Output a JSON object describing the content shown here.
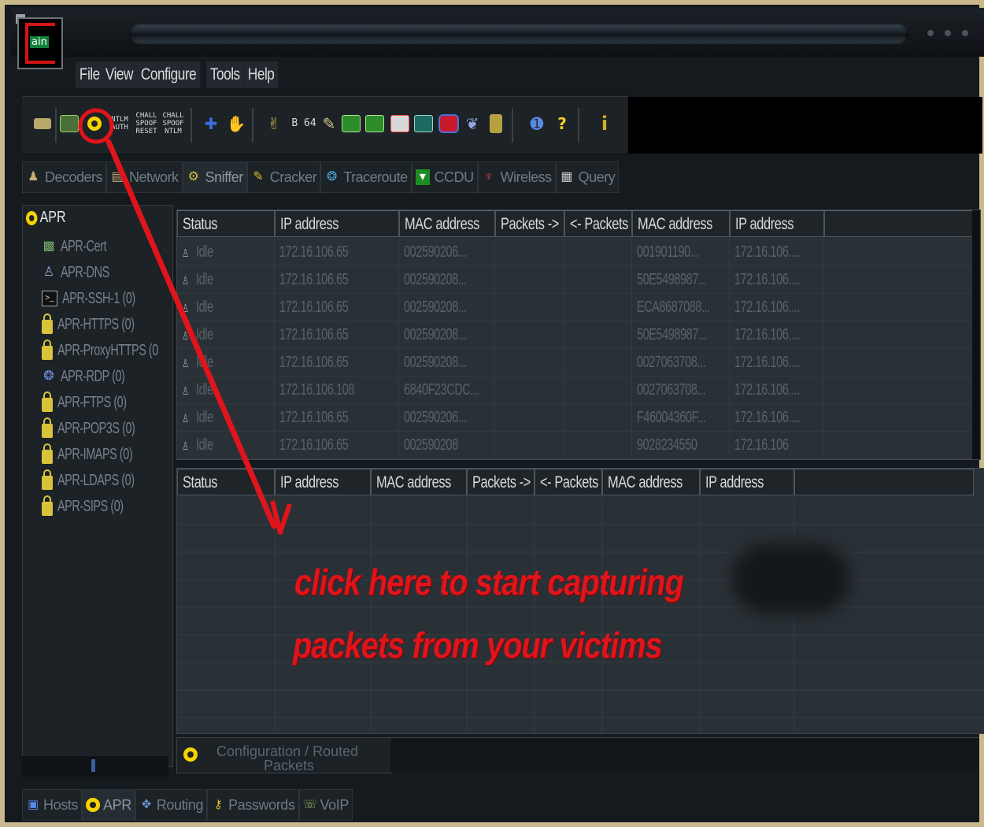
{
  "app": {
    "logo_text": "ain",
    "menu": [
      "File",
      "View",
      "Configure",
      "Tools",
      "Help"
    ]
  },
  "toolbar": {
    "ntlm_auth_label": "NTLM AUTH",
    "challenge_spoof_reset_label": "CHALL SPOOF RESET",
    "challenge_spoof_ntlm_label": "CHALL SPOOF NTLM",
    "b64_label": "B 64",
    "help_label": "?"
  },
  "module_tabs": [
    "Decoders",
    "Network",
    "Sniffer",
    "Cracker",
    "Traceroute",
    "CCDU",
    "Wireless",
    "Query"
  ],
  "tree": {
    "root": "APR",
    "items": [
      "APR-Cert",
      "APR-DNS",
      "APR-SSH-1 (0)",
      "APR-HTTPS (0)",
      "APR-ProxyHTTPS (0",
      "APR-RDP (0)",
      "APR-FTPS (0)",
      "APR-POP3S (0)",
      "APR-IMAPS (0)",
      "APR-LDAPS (0)",
      "APR-SIPS (0)"
    ]
  },
  "upper_grid": {
    "columns": [
      "Status",
      "IP address",
      "MAC address",
      "Packets ->",
      "<- Packets",
      "MAC address",
      "IP address"
    ],
    "rows": [
      [
        "Idle",
        "172.16.106.65",
        "002590206...",
        "",
        "",
        "001901190...",
        "172.16.106...."
      ],
      [
        "Idle",
        "172.16.106.65",
        "002590208...",
        "",
        "",
        "50E5498987...",
        "172.16.106...."
      ],
      [
        "Idle",
        "172.16.106.65",
        "002590208...",
        "",
        "",
        "ECA8687088...",
        "172.16.106...."
      ],
      [
        "Idle",
        "172.16.106.65",
        "002590208...",
        "",
        "",
        "50E5498987...",
        "172.16.106...."
      ],
      [
        "Idle",
        "172.16.106.65",
        "002590208...",
        "",
        "",
        "0027063708...",
        "172.16.106...."
      ],
      [
        "Idle",
        "172.16.106.108",
        "6840F23CDC...",
        "",
        "",
        "0027063708...",
        "172.16.106...."
      ],
      [
        "Idle",
        "172.16.106.65",
        "002590206...",
        "",
        "",
        "F46004360F...",
        "172.16.106...."
      ],
      [
        "Idle",
        "172.16.106.65",
        "002590208",
        "",
        "",
        "9028234550",
        "172.16.106"
      ]
    ]
  },
  "lower_grid": {
    "columns": [
      "Status",
      "IP address",
      "MAC address",
      "Packets ->",
      "<- Packets",
      "MAC address",
      "IP address"
    ]
  },
  "config_panel": {
    "line1": "Configuration / Routed",
    "line2": "Packets"
  },
  "bottom_tabs": [
    "Hosts",
    "APR",
    "Routing",
    "Passwords",
    "VoIP"
  ],
  "annotation": {
    "line1": "click here to start capturing",
    "line2": "packets from your victims",
    "color": "#e0141b"
  }
}
